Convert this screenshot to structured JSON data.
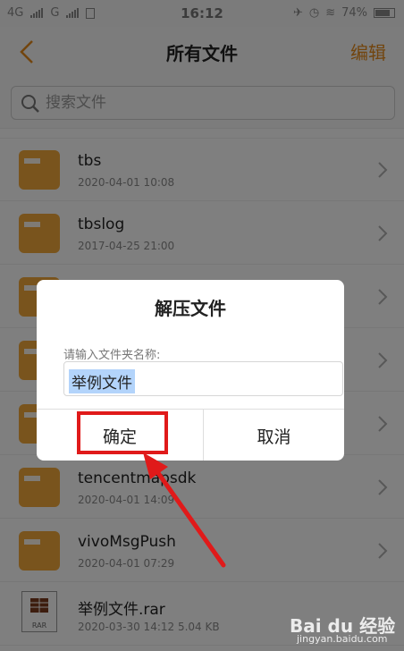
{
  "status_bar": {
    "network1": "4G",
    "network2": "G",
    "time": "16:12",
    "battery": "74%"
  },
  "header": {
    "title": "所有文件",
    "edit_label": "编辑"
  },
  "search": {
    "placeholder": "搜索文件"
  },
  "files": [
    {
      "name": "tbs",
      "meta": "2020-04-01 10:08",
      "type": "folder"
    },
    {
      "name": "tbslog",
      "meta": "2017-04-25 21:00",
      "type": "folder"
    },
    {
      "name": "",
      "meta": "",
      "type": "folder"
    },
    {
      "name": "",
      "meta": "",
      "type": "folder"
    },
    {
      "name": "",
      "meta": "",
      "type": "folder"
    },
    {
      "name": "tencentmapsdk",
      "meta": "2020-04-01 14:09",
      "type": "folder"
    },
    {
      "name": "vivoMsgPush",
      "meta": "2020-04-01 07:29",
      "type": "folder"
    },
    {
      "name": "举例文件.rar",
      "meta": "2020-03-30 14:12  5.04 KB",
      "type": "rar",
      "badge": "RAR"
    }
  ],
  "dialog": {
    "title": "解压文件",
    "label": "请输入文件夹名称:",
    "input_value": "举例文件",
    "confirm_label": "确定",
    "cancel_label": "取消"
  },
  "watermark": {
    "brand": "Bai du 经验",
    "url": "jingyan.baidu.com"
  },
  "colors": {
    "accent": "#e48a1c",
    "folder": "#f2a93b",
    "annotation": "#e01a1a"
  }
}
